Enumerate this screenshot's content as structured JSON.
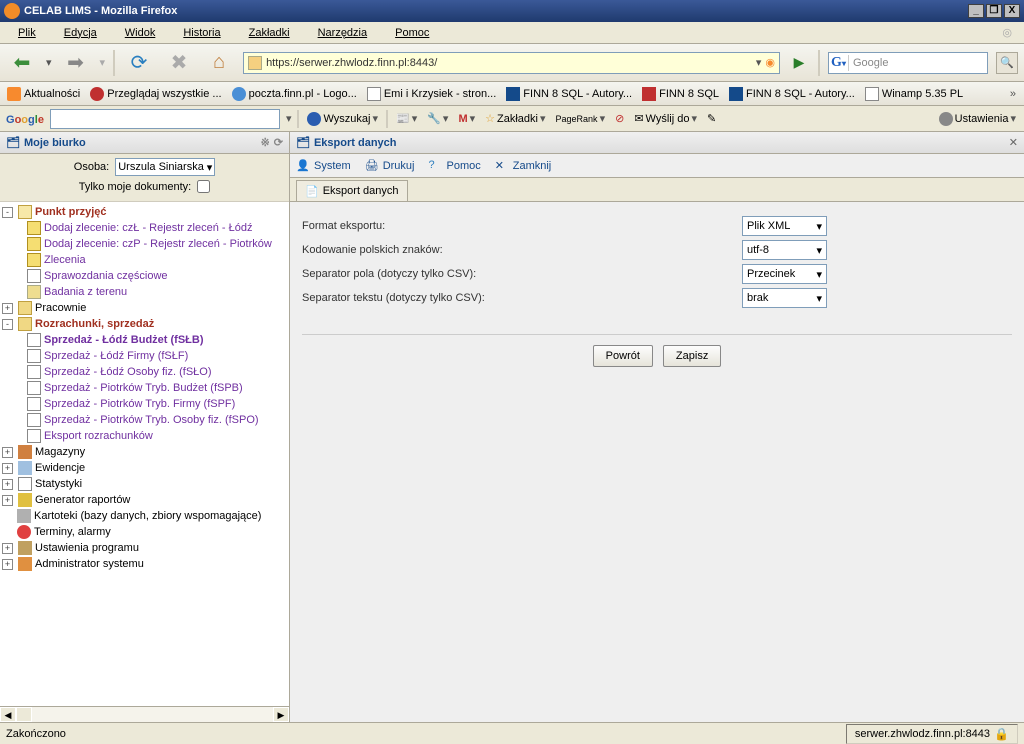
{
  "titlebar": {
    "title": "CELAB LIMS - Mozilla Firefox"
  },
  "menubar": {
    "file": "Plik",
    "edit": "Edycja",
    "view": "Widok",
    "history": "Historia",
    "bookmarks": "Zakładki",
    "tools": "Narzędzia",
    "help": "Pomoc"
  },
  "url": "https://serwer.zhwlodz.finn.pl:8443/",
  "searchbox": {
    "placeholder": "Google"
  },
  "bookmarks": {
    "items": [
      "Aktualności",
      "Przeglądaj wszystkie ...",
      "poczta.finn.pl - Logo...",
      "Emi i Krzysiek - stron...",
      "FINN 8 SQL - Autory...",
      "FINN 8 SQL",
      "FINN 8 SQL - Autory...",
      "Winamp 5.35 PL"
    ]
  },
  "gbar": {
    "search_label": "Wyszukaj",
    "bookmarks": "Zakładki",
    "pagerank": "PageRank",
    "send": "Wyślij do",
    "settings": "Ustawienia"
  },
  "sidebar": {
    "title": "Moje biurko",
    "osoba_label": "Osoba:",
    "osoba_value": "Urszula Siniarska",
    "onlymine": "Tylko moje dokumenty:",
    "tree": {
      "root": "Punkt przyjęć",
      "i1": "Dodaj zlecenie: czŁ - Rejestr zleceń - Łódź",
      "i2": "Dodaj zlecenie: czP - Rejestr zleceń - Piotrków",
      "i3": "Zlecenia",
      "i4": "Sprawozdania częściowe",
      "i5": "Badania z terenu",
      "prac": "Pracownie",
      "rozr": "Rozrachunki, sprzedaż",
      "r1": "Sprzedaż - Łódź Budżet (fSŁB)",
      "r2": "Sprzedaż - Łódź Firmy (fSŁF)",
      "r3": "Sprzedaż - Łódź Osoby fiz. (fSŁO)",
      "r4": "Sprzedaż - Piotrków Tryb. Budżet (fSPB)",
      "r5": "Sprzedaż - Piotrków Tryb. Firmy (fSPF)",
      "r6": "Sprzedaż - Piotrków Tryb. Osoby fiz. (fSPO)",
      "r7": "Eksport rozrachunków",
      "mag": "Magazyny",
      "ewi": "Ewidencje",
      "stat": "Statystyki",
      "gen": "Generator raportów",
      "kart": "Kartoteki (bazy danych, zbiory wspomagające)",
      "term": "Terminy, alarmy",
      "ust": "Ustawienia programu",
      "adm": "Administrator systemu"
    }
  },
  "panel": {
    "title": "Eksport danych",
    "toolbar": {
      "system": "System",
      "print": "Drukuj",
      "help": "Pomoc",
      "close": "Zamknij"
    },
    "tab": "Eksport danych",
    "form": {
      "format_label": "Format eksportu:",
      "format_value": "Plik XML",
      "encoding_label": "Kodowanie polskich znaków:",
      "encoding_value": "utf-8",
      "fieldsep_label": "Separator pola (dotyczy tylko CSV):",
      "fieldsep_value": "Przecinek",
      "textsep_label": "Separator tekstu (dotyczy tylko CSV):",
      "textsep_value": "brak"
    },
    "btn_back": "Powrót",
    "btn_save": "Zapisz"
  },
  "status": {
    "left": "Zakończono",
    "right": "serwer.zhwlodz.finn.pl:8443"
  }
}
